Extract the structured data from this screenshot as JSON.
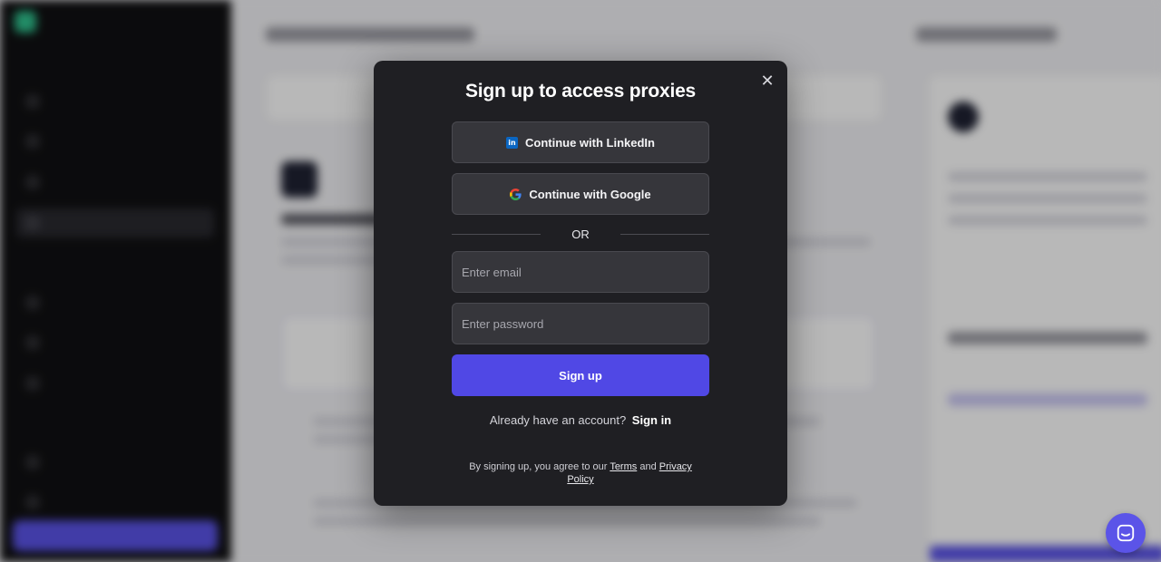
{
  "modal": {
    "title": "Sign up to access proxies",
    "close_icon": "close-icon",
    "linkedin_label": "Continue with LinkedIn",
    "google_label": "Continue with Google",
    "divider_text": "OR",
    "email_placeholder": "Enter email",
    "password_placeholder": "Enter password",
    "signup_label": "Sign up",
    "have_account_text": "Already have an account?",
    "signin_label": "Sign in",
    "legal_prefix": "By signing up, you agree to our",
    "terms_label": "Terms",
    "and_text": "and",
    "privacy_label": "Privacy Policy"
  },
  "chat": {
    "icon": "chat-icon"
  },
  "colors": {
    "modal_bg": "#1f1f23",
    "primary": "#5048e5",
    "linkedin": "#0a66c2"
  }
}
